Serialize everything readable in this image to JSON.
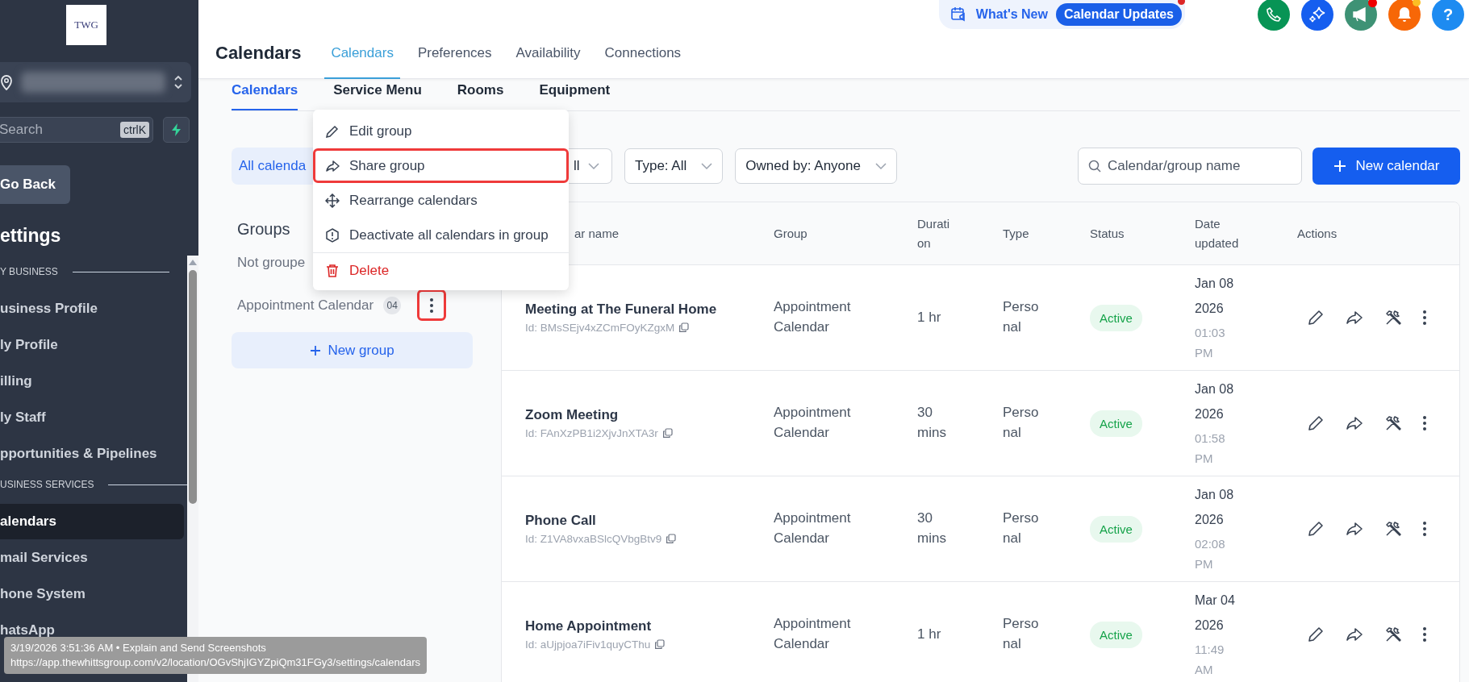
{
  "sidebar": {
    "logo": "TWG",
    "search": {
      "placeholder": "Search",
      "shortcut": "ctrlK"
    },
    "back_button": "Go Back",
    "heading": "ettings",
    "sections": [
      {
        "label": "Y BUSINESS",
        "items": [
          {
            "label": "usiness Profile",
            "selected": false
          },
          {
            "label": "ly Profile",
            "selected": false
          },
          {
            "label": "illing",
            "selected": false
          },
          {
            "label": "ly Staff",
            "selected": false
          },
          {
            "label": "pportunities & Pipelines",
            "selected": false
          }
        ]
      },
      {
        "label": "USINESS SERVICES",
        "items": [
          {
            "label": "alendars",
            "selected": true
          },
          {
            "label": "mail Services",
            "selected": false
          },
          {
            "label": "hone System",
            "selected": false
          },
          {
            "label": "hatsApp",
            "selected": false
          }
        ]
      }
    ]
  },
  "header": {
    "whats_new": {
      "label": "What's New",
      "badge": "Calendar Updates"
    },
    "help": "?",
    "title": "Calendars",
    "tabs": [
      {
        "label": "Calendars",
        "selected": true
      },
      {
        "label": "Preferences",
        "selected": false
      },
      {
        "label": "Availability",
        "selected": false
      },
      {
        "label": "Connections",
        "selected": false
      }
    ]
  },
  "subtabs": [
    {
      "label": "Calendars",
      "selected": true
    },
    {
      "label": "Service Menu",
      "selected": false
    },
    {
      "label": "Rooms",
      "selected": false
    },
    {
      "label": "Equipment",
      "selected": false
    }
  ],
  "filters": {
    "all_calendars": "All calenda",
    "dropdown_1": "ll",
    "type": "Type: All",
    "owned_by": "Owned by: Anyone",
    "search": {
      "placeholder": "Calendar/group name"
    },
    "new_button": "New calendar"
  },
  "groups": {
    "title": "Groups",
    "items": [
      {
        "name": "Not groupe"
      },
      {
        "name": "Appointment Calendar",
        "count": "04",
        "menu_highlighted": true
      }
    ],
    "new_button": "New group"
  },
  "group_menu": {
    "items": [
      {
        "label": "Edit group",
        "kind": "edit",
        "highlighted": false
      },
      {
        "label": "Share group",
        "kind": "share",
        "highlighted": true
      },
      {
        "label": "Rearrange calendars",
        "kind": "move",
        "highlighted": false
      },
      {
        "label": "Deactivate all calendars in group",
        "kind": "deactivate",
        "highlighted": false
      },
      {
        "label": "Delete",
        "kind": "delete",
        "highlighted": false
      }
    ]
  },
  "table": {
    "columns": [
      "ar name",
      "Group",
      "Duration",
      "Type",
      "Status",
      "Date updated",
      "Actions"
    ],
    "rows": [
      {
        "name": "Meeting at The Funeral Home",
        "id": "Id: BMsSEjv4xZCmFOyKZgxM",
        "group": "Appointment Calendar",
        "duration": "1 hr",
        "type": "Personal",
        "status": "Active",
        "date": "Jan 08 2026",
        "time": "01:03 PM"
      },
      {
        "name": "Zoom Meeting",
        "id": "Id: FAnXzPB1i2XjvJnXTA3r",
        "group": "Appointment Calendar",
        "duration": "30 mins",
        "type": "Personal",
        "status": "Active",
        "date": "Jan 08 2026",
        "time": "01:58 PM"
      },
      {
        "name": "Phone Call",
        "id": "Id: Z1VA8vxaBSlcQVbgBtv9",
        "group": "Appointment Calendar",
        "duration": "30 mins",
        "type": "Personal",
        "status": "Active",
        "date": "Jan 08 2026",
        "time": "02:08 PM"
      },
      {
        "name": "Home Appointment",
        "id": "Id: aUjpjoa7iFiv1quyCThu",
        "group": "Appointment Calendar",
        "duration": "1 hr",
        "type": "Personal",
        "status": "Active",
        "date": "Mar 04 2026",
        "time": "11:49 AM"
      }
    ]
  },
  "tooltip": {
    "line_1": "3/19/2026 3:51:36 AM • Explain and Send Screenshots",
    "line_2": "https://app.thewhittsgroup.com/v2/location/OGvShjIGYZpiQm31FGy3/settings/calendars"
  }
}
